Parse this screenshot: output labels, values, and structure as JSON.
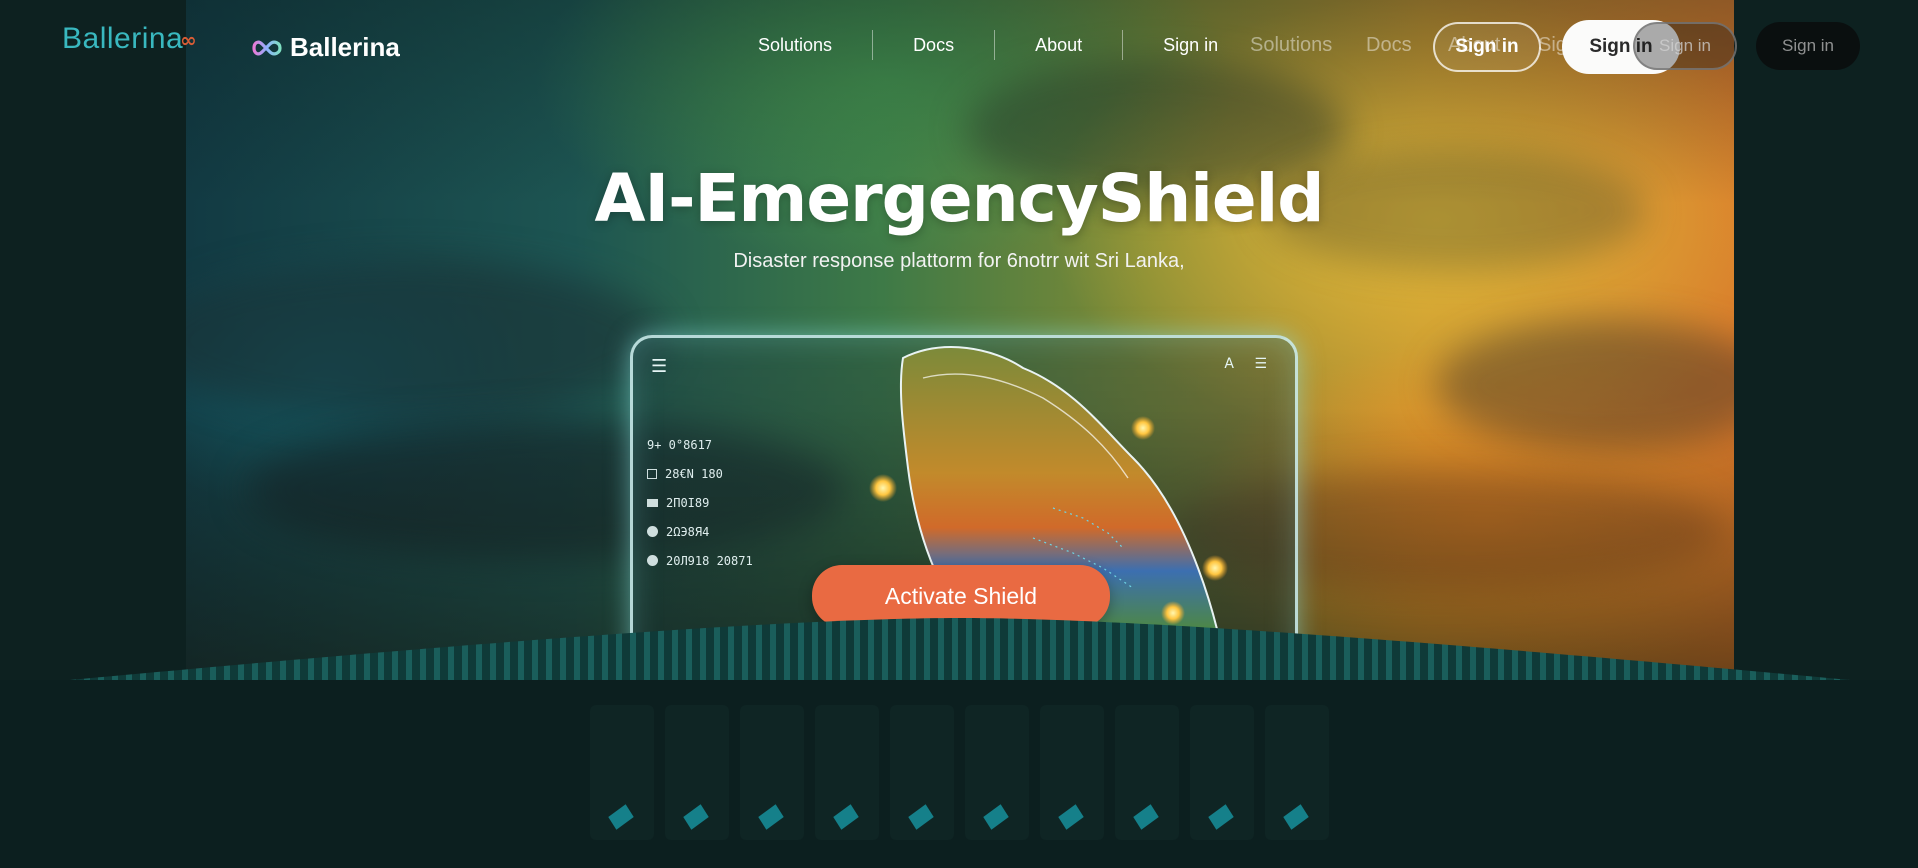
{
  "header": {
    "logo_left_text": "Ballerina",
    "logo_left_symbol": "∞",
    "brand_name": "Ballerina",
    "brand_icon": "infinity-logo-icon",
    "nav": [
      "Solutions",
      "Docs",
      "About",
      "Sign in"
    ],
    "ghost_nav": {
      "solutions": "Solutions",
      "docs": "Docs",
      "about": "About",
      "sign_in": "Sign in"
    },
    "buttons": {
      "outline": "Sign in",
      "white": "Sign in",
      "ghost": "Sign in",
      "dark": "Sign in"
    }
  },
  "hero": {
    "title": "AI-EmergencyShield",
    "subtitle": "Disaster response plattorm for 6notrr wit Sri Lanka,",
    "cta": "Activate Shield"
  },
  "device": {
    "menu_icon": "hamburger-icon",
    "top_icons": "A ☰",
    "list": [
      {
        "icon": "none",
        "text": "9+ 0°8617"
      },
      {
        "icon": "square",
        "text": "28€N 180"
      },
      {
        "icon": "bar",
        "text": "2Π0Ι89"
      },
      {
        "icon": "dot",
        "text": "2ΩЭ8Я4"
      },
      {
        "icon": "dot",
        "text": "20Л918 20871"
      }
    ]
  },
  "colors": {
    "background": "#0c1f1f",
    "accent_teal": "#39b8bf",
    "accent_orange": "#e96a42"
  },
  "bottom_pillars": 10
}
